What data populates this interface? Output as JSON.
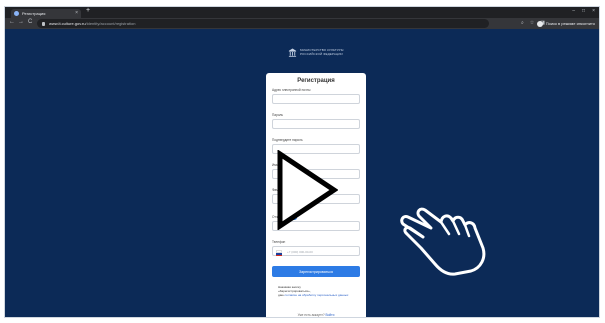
{
  "browser": {
    "tab_title": "Регистрация",
    "tab_close": "×",
    "new_tab": "+",
    "window_controls": [
      "–",
      "□",
      "×"
    ],
    "nav": [
      "←",
      "→",
      "C"
    ],
    "url_domain": "www.it.culture.gov.ru",
    "url_path": "/identity/account/registration",
    "toolbar_icons": [
      "search-icon",
      "star-icon",
      "sidebar-icon"
    ],
    "toolbar_glyphs": [
      "⌕",
      "☆",
      "◨"
    ],
    "profile_label": "Поиск в режиме инкогнито"
  },
  "logo": {
    "line1": "МИНИСТЕРСТВО КУЛЬТУРЫ",
    "line2": "РОССИЙСКОЙ ФЕДЕРАЦИИ"
  },
  "form": {
    "title": "Регистрация",
    "email_label": "Адрес электронной почты",
    "password_label": "Пароль",
    "confirm_label": "Подтвердите пароль",
    "name_label": "Имя",
    "surname_label": "Фам",
    "patronymic_label": "Отчество",
    "patronymic_toggle_on": true,
    "phone_label": "Телефон",
    "phone_placeholder": "+7 (000) 000-00-00",
    "submit_label": "Зарегистрироваться",
    "agree_text1": "Нажимая кнопку",
    "agree_text2": "«Зарегистрироваться»,",
    "agree_text3": "даю",
    "agree_link": "согласие на обработку персональных данных",
    "login_prompt": "Уже есть аккаунт?",
    "login_link": "Войти"
  },
  "colors": {
    "background": "#0c2a57",
    "accent": "#2d7be5",
    "link": "#2d63c8"
  }
}
